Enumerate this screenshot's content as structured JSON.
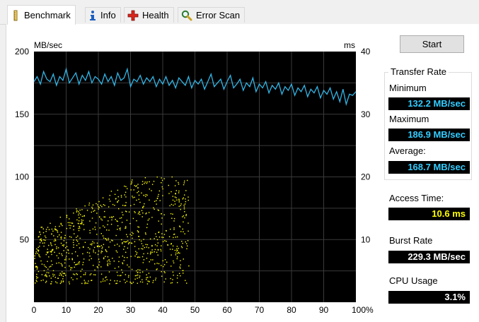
{
  "tabs": [
    {
      "label": "Benchmark",
      "icon": "ruler-icon",
      "active": true
    },
    {
      "label": "Info",
      "icon": "info-icon",
      "active": false
    },
    {
      "label": "Health",
      "icon": "health-cross-icon",
      "active": false
    },
    {
      "label": "Error Scan",
      "icon": "magnifier-icon",
      "active": false
    }
  ],
  "start_button": "Start",
  "transfer_rate": {
    "title": "Transfer Rate",
    "minimum_label": "Minimum",
    "minimum_value": "132.2 MB/sec",
    "maximum_label": "Maximum",
    "maximum_value": "186.9 MB/sec",
    "average_label": "Average:",
    "average_value": "168.7 MB/sec"
  },
  "access_time": {
    "label": "Access Time:",
    "value": "10.6 ms"
  },
  "burst_rate": {
    "label": "Burst Rate",
    "value": "229.3 MB/sec"
  },
  "cpu_usage": {
    "label": "CPU Usage",
    "value": "3.1%"
  },
  "colors": {
    "transfer_line": "#33b5e5",
    "access_dots": "#ffff00",
    "background": "#000000",
    "grid": "#3a3a3a"
  },
  "chart_data": {
    "type": "line",
    "y_left_label": "MB/sec",
    "y_right_label": "ms",
    "ylim_left": [
      0,
      200
    ],
    "ylim_right": [
      0,
      40
    ],
    "xlim": [
      0,
      100
    ],
    "y_left_ticks": [
      "200",
      "150",
      "100",
      "50"
    ],
    "y_right_ticks": [
      "40",
      "30",
      "20",
      "10"
    ],
    "x_ticks": [
      "0",
      "10",
      "20",
      "30",
      "40",
      "50",
      "60",
      "70",
      "80",
      "90",
      "100%"
    ],
    "grid": true,
    "transfer_rate_series": {
      "x": [
        0,
        1,
        2,
        3,
        4,
        5,
        6,
        7,
        8,
        9,
        10,
        11,
        12,
        13,
        14,
        15,
        16,
        17,
        18,
        19,
        20,
        21,
        22,
        23,
        24,
        25,
        26,
        27,
        28,
        29,
        30,
        31,
        32,
        33,
        34,
        35,
        36,
        37,
        38,
        39,
        40,
        41,
        42,
        43,
        44,
        45,
        46,
        47,
        48,
        49,
        50,
        51,
        52,
        53,
        54,
        55,
        56,
        57,
        58,
        59,
        60,
        61,
        62,
        63,
        64,
        65,
        66,
        67,
        68,
        69,
        70,
        71,
        72,
        73,
        74,
        75,
        76,
        77,
        78,
        79,
        80,
        81,
        82,
        83,
        84,
        85,
        86,
        87,
        88,
        89,
        90,
        91,
        92,
        93,
        94,
        95,
        96,
        97,
        98,
        99,
        100
      ],
      "y": [
        176,
        180,
        174,
        184,
        178,
        176,
        182,
        173,
        180,
        177,
        186,
        175,
        179,
        183,
        174,
        181,
        177,
        184,
        175,
        180,
        178,
        174,
        182,
        176,
        180,
        173,
        183,
        177,
        179,
        186,
        172,
        178,
        176,
        181,
        174,
        179,
        176,
        180,
        172,
        178,
        174,
        180,
        173,
        177,
        171,
        179,
        176,
        173,
        180,
        171,
        177,
        174,
        178,
        170,
        176,
        182,
        172,
        175,
        178,
        170,
        176,
        181,
        171,
        174,
        178,
        169,
        175,
        172,
        179,
        168,
        174,
        171,
        176,
        167,
        173,
        170,
        175,
        166,
        172,
        169,
        174,
        165,
        171,
        168,
        173,
        164,
        170,
        167,
        172,
        163,
        169,
        166,
        171,
        162,
        168,
        160,
        170,
        158,
        166,
        165,
        168
      ]
    },
    "access_time_scatter": {
      "x_range": [
        0,
        48
      ],
      "y_range_ms": [
        3,
        18
      ],
      "point_count": 900
    }
  }
}
